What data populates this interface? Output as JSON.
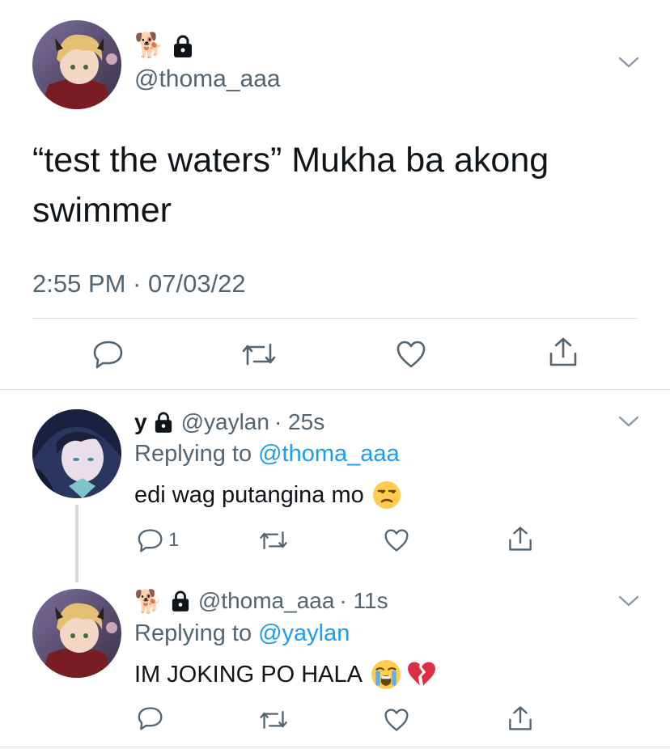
{
  "main_tweet": {
    "display_name": "🐕",
    "handle": "@thoma_aaa",
    "text_line1": "“test the waters” Mukha ba akong",
    "text_line2": "swimmer",
    "timestamp": "2:55 PM · 07/03/22"
  },
  "replies": [
    {
      "display_name": "y",
      "handle": "@yaylan",
      "time": "· 25s",
      "replying_label": "Replying to",
      "replying_handle": "@thoma_aaa",
      "text": "edi wag putangina mo",
      "reply_count": "1"
    },
    {
      "display_name": "🐕",
      "handle": "@thoma_aaa",
      "time": "· 11s",
      "replying_label": "Replying to",
      "replying_handle": "@yaylan",
      "text": "IM JOKING PO HALA",
      "reply_count": ""
    }
  ],
  "colors": {
    "text": "#0f1419",
    "muted": "#536471",
    "link": "#1d9bf0",
    "divider": "#dcdfe2"
  },
  "icons": [
    "lock-icon",
    "chevron-down-icon",
    "reply-icon",
    "retweet-icon",
    "like-icon",
    "share-icon"
  ]
}
